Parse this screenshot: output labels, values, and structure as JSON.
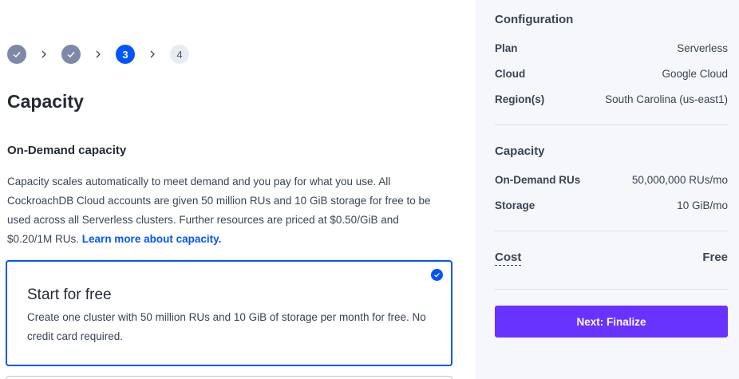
{
  "stepper": {
    "steps": [
      {
        "label": "",
        "state": "done"
      },
      {
        "label": "",
        "state": "done"
      },
      {
        "label": "3",
        "state": "active"
      },
      {
        "label": "4",
        "state": "pending"
      }
    ]
  },
  "main": {
    "title": "Capacity",
    "section_title": "On-Demand capacity",
    "description": "Capacity scales automatically to meet demand and you pay for what you use. All CockroachDB Cloud accounts are given 50 million RUs and 10 GiB storage for free to be used across all Serverless clusters. Further resources are priced at $0.50/GiB and $0.20/1M RUs. ",
    "learn_more_link": "Learn more about capacity.",
    "card": {
      "title": "Start for free",
      "description": "Create one cluster with 50 million RUs and 10 GiB of storage per month for free. No credit card required.",
      "selected": true
    }
  },
  "sidebar": {
    "configuration": {
      "heading": "Configuration",
      "rows": [
        {
          "label": "Plan",
          "value": "Serverless"
        },
        {
          "label": "Cloud",
          "value": "Google Cloud"
        },
        {
          "label": "Region(s)",
          "value": "South Carolina (us-east1)"
        }
      ]
    },
    "capacity": {
      "heading": "Capacity",
      "rows": [
        {
          "label": "On-Demand RUs",
          "value": "50,000,000 RUs/mo"
        },
        {
          "label": "Storage",
          "value": "10 GiB/mo"
        }
      ]
    },
    "cost": {
      "label": "Cost",
      "value": "Free"
    },
    "next_button": "Next: Finalize"
  },
  "colors": {
    "accent_blue": "#0055ff",
    "button_purple": "#6933ff",
    "step_done": "#7e89a9",
    "sidebar_bg": "#f5f7fa"
  },
  "icons": {
    "step_done": "check-icon",
    "step_separator": "chevron-right-icon",
    "card_selected": "check-circle-icon"
  }
}
